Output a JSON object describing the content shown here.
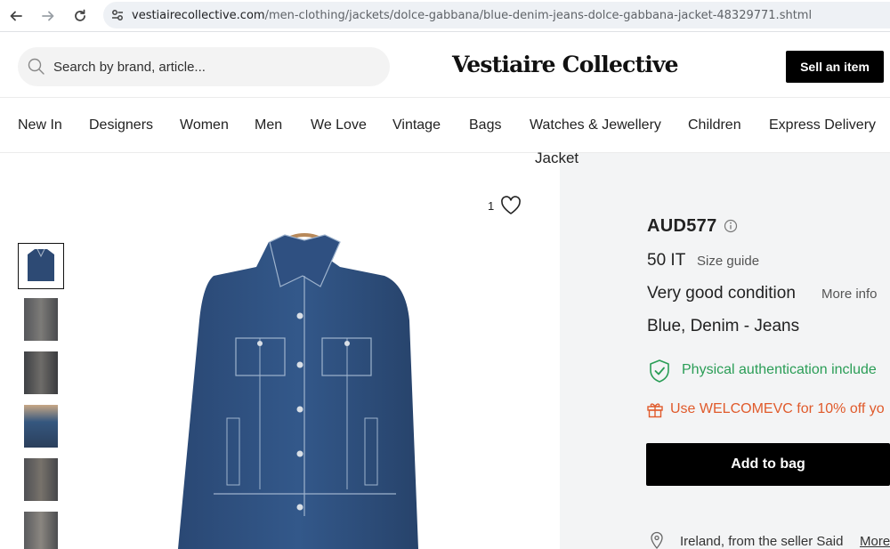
{
  "browser": {
    "url_domain": "vestiairecollective.com",
    "url_path": "/men-clothing/jackets/dolce-gabbana/blue-denim-jeans-dolce-gabbana-jacket-48329771.shtml"
  },
  "header": {
    "search_placeholder": "Search by brand, article...",
    "logo": "Vestiaire Collective",
    "sell_label": "Sell an item"
  },
  "categories": [
    "New In",
    "Designers",
    "Women",
    "Men",
    "We Love",
    "Vintage",
    "Bags",
    "Watches & Jewellery",
    "Children",
    "Express Delivery"
  ],
  "product": {
    "title_fragment": "Jacket",
    "likes": "1",
    "price": "AUD577",
    "size": "50 IT",
    "size_guide": "Size guide",
    "condition": "Very good condition",
    "more_info": "More info",
    "material": "Blue, Denim - Jeans",
    "authentication": "Physical authentication include",
    "promo": "Use WELCOMEVC for 10% off yo",
    "add_to_bag": "Add to bag",
    "seller": "Ireland, from the seller Said",
    "seller_more": "More"
  },
  "colors": {
    "auth_green": "#2a9d56",
    "promo_orange": "#e05a2b",
    "panel_bg": "#f3f4f5"
  }
}
